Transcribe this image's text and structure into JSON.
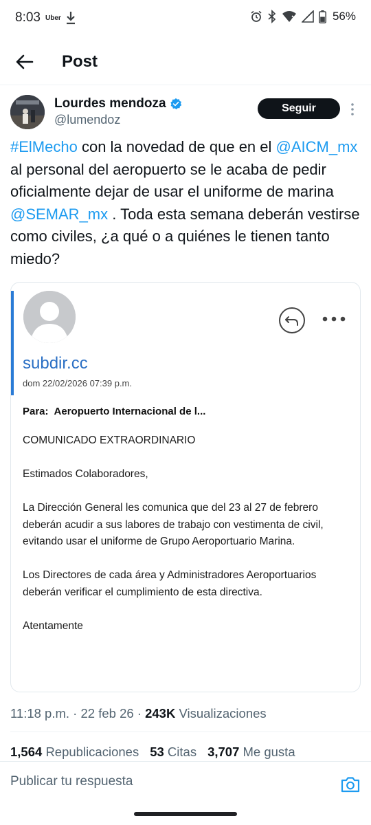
{
  "status_bar": {
    "time": "8:03",
    "uber_label": "Uber",
    "battery_percent": "56%"
  },
  "header": {
    "title": "Post"
  },
  "author": {
    "name": "Lourdes mendoza",
    "handle": "@lumendoz",
    "follow_label": "Seguir"
  },
  "tweet": {
    "segments": [
      {
        "text": "#ElMecho",
        "link": true
      },
      {
        "text": " con la novedad de que en el ",
        "link": false
      },
      {
        "text": "@AICM_mx",
        "link": true
      },
      {
        "text": " al personal del aeropuerto se le acaba de pedir oficialmente dejar de usar el uniforme de marina ",
        "link": false
      },
      {
        "text": "@SEMAR_mx",
        "link": true
      },
      {
        "text": " . Toda esta semana deberán vestirse como civiles, ¿a qué o a quiénes le tienen tanto miedo?",
        "link": false
      }
    ]
  },
  "email": {
    "sender": "subdir.cc",
    "date": "dom 22/02/2026 07:39 p.m.",
    "to_label": "Para:",
    "to_value": "Aeropuerto Internacional de l...",
    "body": {
      "heading": "COMUNICADO EXTRAORDINARIO",
      "greeting": "Estimados Colaboradores,",
      "p1": "La Dirección General les comunica que del 23 al 27 de febrero deberán acudir a sus labores de trabajo con vestimenta de civil, evitando usar el uniforme de Grupo Aeroportuario Marina.",
      "p2": "Los Directores de cada área y Administradores Aeroportuarios deberán verificar el cumplimiento de esta directiva.",
      "closing": "Atentamente"
    }
  },
  "meta": {
    "time": "11:18 p.m.",
    "separator": " · ",
    "date": "22 feb 26",
    "views_count": "243K",
    "views_label": "Visualizaciones"
  },
  "stats": {
    "reposts_count": "1,564",
    "reposts_label": "Republicaciones",
    "quotes_count": "53",
    "quotes_label": "Citas",
    "likes_count": "3,707",
    "likes_label": "Me gusta"
  },
  "reply": {
    "placeholder": "Publicar tu respuesta"
  },
  "icons": {
    "back": "arrow-left-icon",
    "verified": "verified-badge-icon",
    "more": "more-vert-icon",
    "camera": "camera-icon",
    "reply_circle": "reply-circle-icon"
  },
  "colors": {
    "link": "#1d9bf0",
    "follow_bg": "#0f1419",
    "email_accent": "#2a7bd6"
  }
}
